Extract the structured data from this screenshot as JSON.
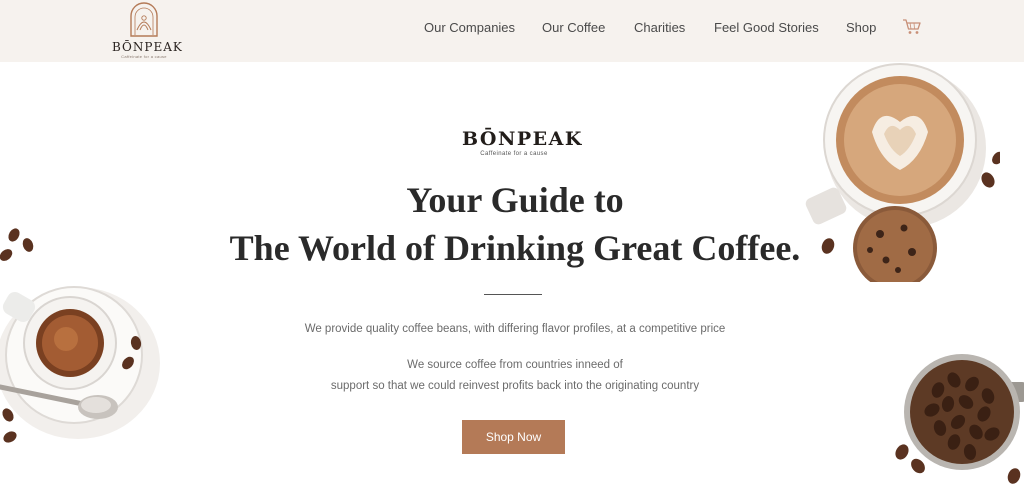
{
  "header": {
    "logo": {
      "word": "BŌNPEAK"
    },
    "nav": [
      "Our Companies",
      "Our Coffee",
      "Charities",
      "Feel Good Stories",
      "Shop"
    ],
    "cart_icon": "shopping-cart-icon"
  },
  "hero": {
    "brand_word": "BŌNPEAK",
    "brand_tag": "Caffeinate for a cause",
    "title_line1": "Your Guide to",
    "title_line2": "The World of Drinking Great Coffee.",
    "desc_line1": "We provide quality coffee beans, with differing flavor profiles, at a competitive price",
    "desc_line2": "We source coffee from countries inneed of",
    "desc_line3": "support so that we could reinvest profits back into the originating country",
    "cta_label": "Shop Now"
  },
  "colors": {
    "header_bg": "#f6f2ee",
    "accent": "#b47a57",
    "title": "#2a2a2a",
    "body_text": "#6b6b6b"
  }
}
